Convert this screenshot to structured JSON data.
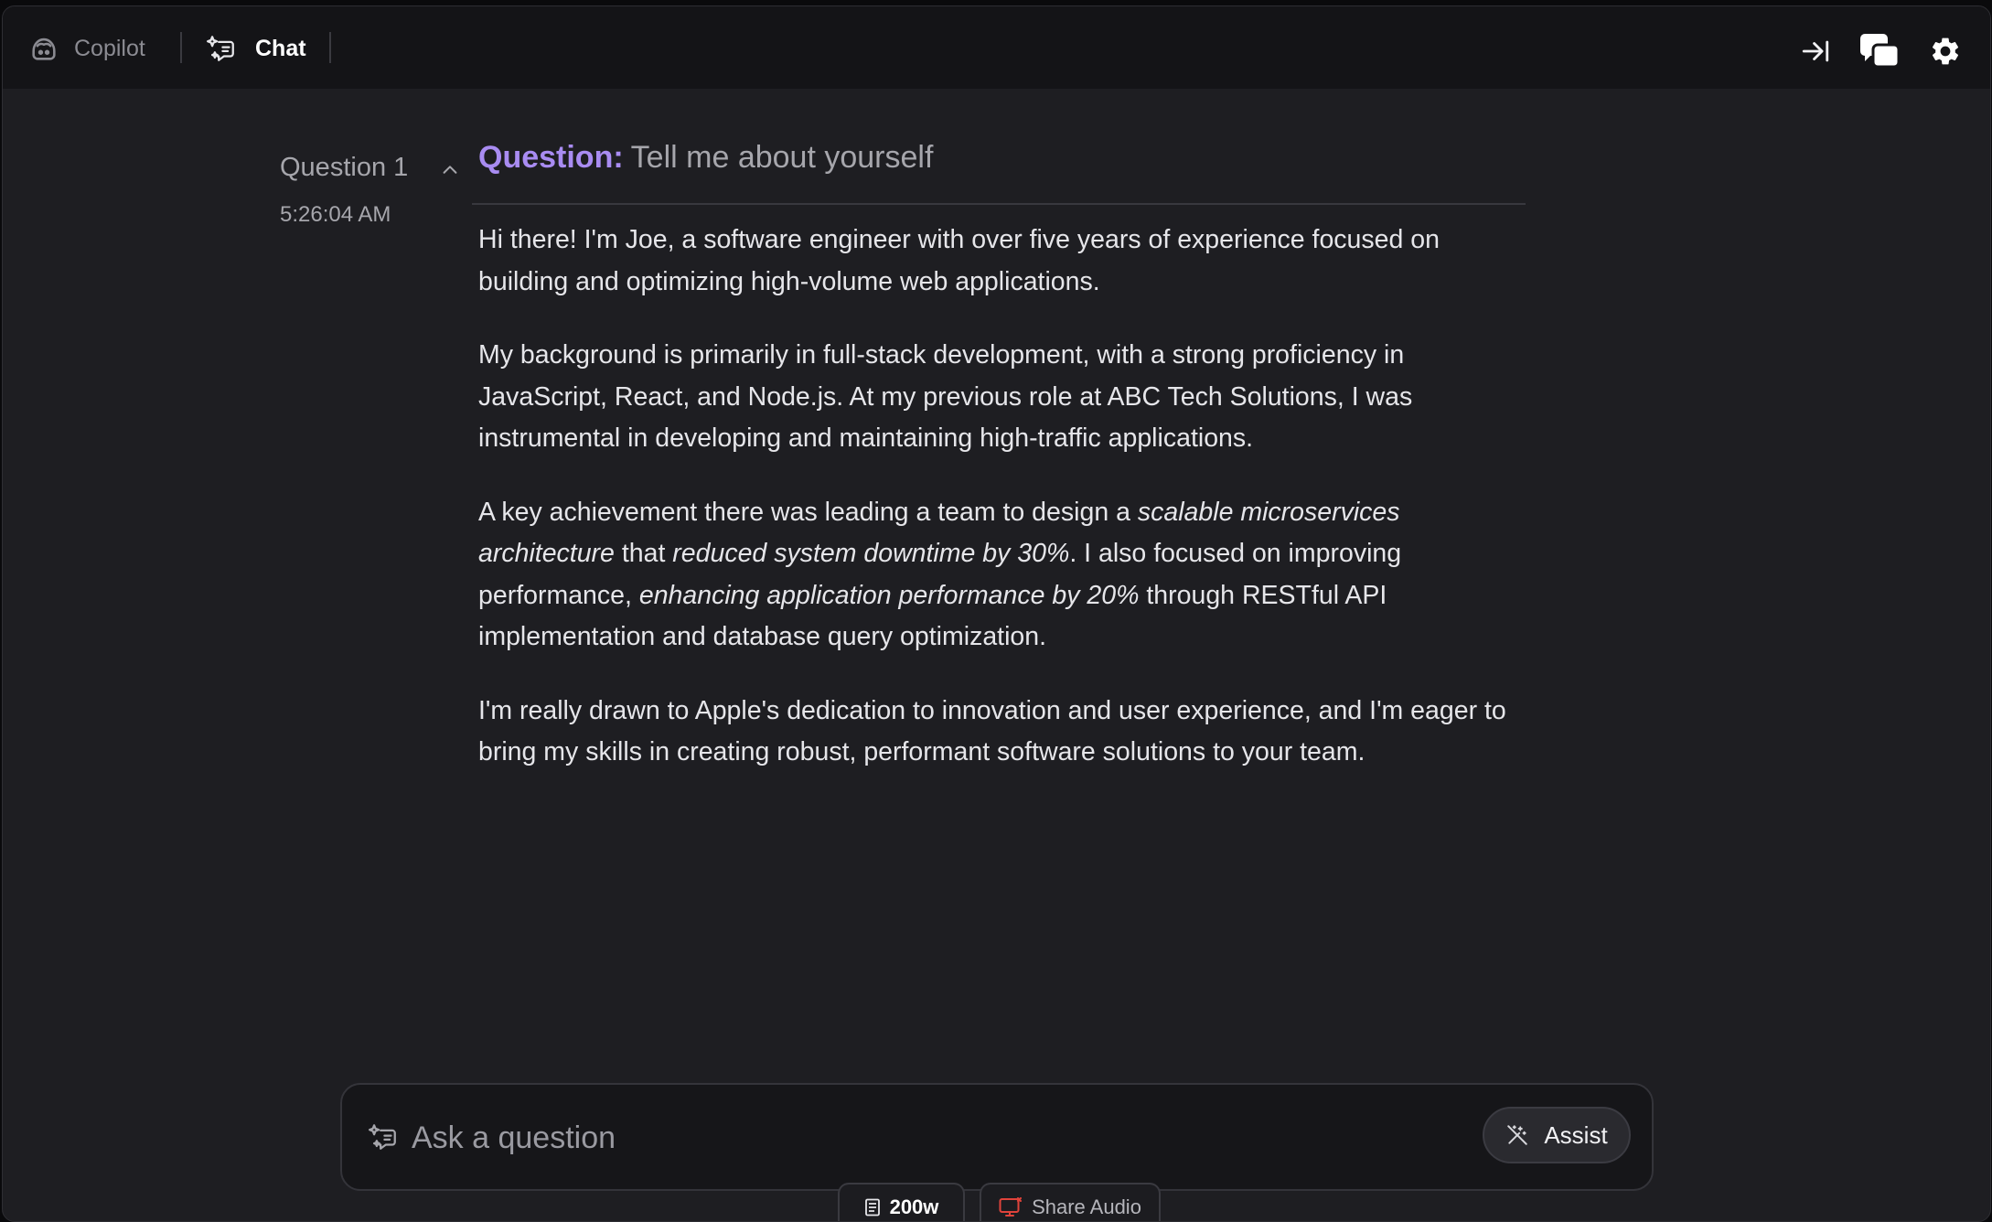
{
  "header": {
    "copilot_label": "Copilot",
    "chat_label": "Chat",
    "icons": [
      "copilot-icon",
      "chat-sparkle-icon",
      "collapse-to-right-icon",
      "chat-bubbles-icon",
      "gear-icon"
    ]
  },
  "conversation": {
    "question_label": "Question 1",
    "timestamp": "5:26:04 AM",
    "question_prefix": "Question:",
    "question_text": "Tell me about yourself",
    "answer": {
      "p1": "Hi there! I'm Joe, a software engineer with over five years of experience focused on building and optimizing high-volume web applications.",
      "p2": "My background is primarily in full-stack development, with a strong proficiency in JavaScript, React, and Node.js. At my previous role at ABC Tech Solutions, I was instrumental in developing and maintaining high-traffic applications.",
      "p3_a": "A key achievement there was leading a team to design a ",
      "p3_em1": "scalable microservices architecture",
      "p3_b": " that ",
      "p3_em2": "reduced system downtime by 30%",
      "p3_c": ". I also focused on improving performance, ",
      "p3_em3": "enhancing application performance by 20%",
      "p3_d": " through RESTful API implementation and database query optimization.",
      "p4": "I'm really drawn to Apple's dedication to innovation and user experience, and I'm eager to bring my skills in creating robust, performant software solutions to your team."
    }
  },
  "input": {
    "placeholder": "Ask a question",
    "value": "",
    "assist_label": "Assist"
  },
  "footer": {
    "word_limit_label": "200w",
    "share_audio_label": "Share Audio"
  },
  "colors": {
    "accent_purple": "#a98cf2",
    "share_audio_icon": "#e0433b",
    "background": "#1e1e22",
    "topbar": "#141417"
  }
}
